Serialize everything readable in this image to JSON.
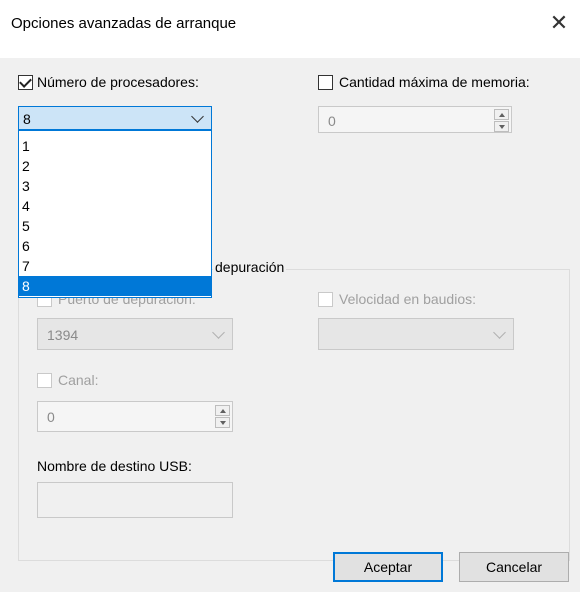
{
  "window": {
    "title": "Opciones avanzadas de arranque",
    "close_glyph": "✕"
  },
  "processors": {
    "checkbox_label": "Número de procesadores:",
    "checked": true,
    "selected_value": "8",
    "options": [
      "1",
      "2",
      "3",
      "4",
      "5",
      "6",
      "7",
      "8"
    ]
  },
  "memory": {
    "checkbox_label": "Cantidad máxima de memoria:",
    "checked": false,
    "value": "0"
  },
  "debug": {
    "group_label_visible": "depuración",
    "port_label": "Puerto de depuración:",
    "port_value": "1394",
    "baud_label": "Velocidad en baudios:",
    "baud_value": "",
    "channel_label": "Canal:",
    "channel_value": "0",
    "usb_label": "Nombre de destino USB:",
    "usb_value": ""
  },
  "buttons": {
    "ok": "Aceptar",
    "cancel": "Cancelar"
  },
  "colors": {
    "accent": "#0078d7",
    "selection_bg": "#cce4f7",
    "dialog_bg": "#f0f0f0",
    "disabled_text": "#a0a0a0"
  }
}
